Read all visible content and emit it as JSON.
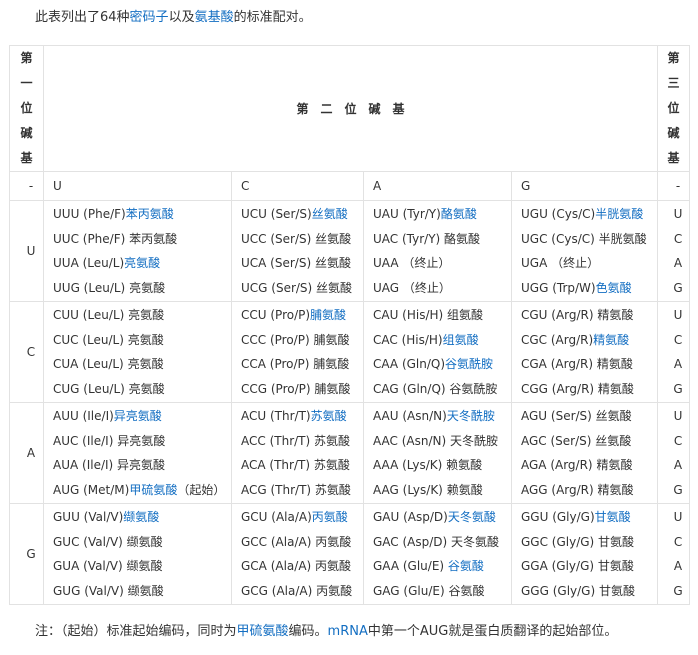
{
  "intro": {
    "text_before": "此表列出了64种",
    "link1": "密码子",
    "text_mid": "以及",
    "link2": "氨基酸",
    "text_after": "的标准配对。"
  },
  "table": {
    "first_base_header": "第一位碱基",
    "second_base_header": "第二位碱基",
    "third_base_header": "第三位碱基",
    "dash": "-",
    "second_bases": [
      "U",
      "C",
      "A",
      "G"
    ],
    "rows": [
      {
        "first": "U",
        "third": [
          "U",
          "C",
          "A",
          "G"
        ],
        "cells": [
          [
            {
              "code": "UUU (Phe/F)",
              "aa": "苯丙氨酸",
              "link": true
            },
            {
              "code": "UUC (Phe/F) ",
              "aa": "苯丙氨酸",
              "link": false
            },
            {
              "code": "UUA (Leu/L)",
              "aa": "亮氨酸",
              "link": true
            },
            {
              "code": "UUG (Leu/L) ",
              "aa": "亮氨酸",
              "link": false
            }
          ],
          [
            {
              "code": "UCU (Ser/S)",
              "aa": "丝氨酸",
              "link": true
            },
            {
              "code": "UCC (Ser/S) ",
              "aa": "丝氨酸",
              "link": false
            },
            {
              "code": "UCA (Ser/S) ",
              "aa": "丝氨酸",
              "link": false
            },
            {
              "code": "UCG (Ser/S) ",
              "aa": "丝氨酸",
              "link": false
            }
          ],
          [
            {
              "code": "UAU (Tyr/Y)",
              "aa": "酪氨酸",
              "link": true
            },
            {
              "code": "UAC (Tyr/Y) ",
              "aa": "酪氨酸",
              "link": false
            },
            {
              "code": "UAA ",
              "aa": "（终止）",
              "link": false
            },
            {
              "code": "UAG ",
              "aa": "（终止）",
              "link": false
            }
          ],
          [
            {
              "code": "UGU (Cys/C)",
              "aa": "半胱氨酸",
              "link": true
            },
            {
              "code": "UGC (Cys/C) ",
              "aa": "半胱氨酸",
              "link": false
            },
            {
              "code": "UGA ",
              "aa": "（终止）",
              "link": false
            },
            {
              "code": "UGG (Trp/W)",
              "aa": "色氨酸",
              "link": true
            }
          ]
        ]
      },
      {
        "first": "C",
        "third": [
          "U",
          "C",
          "A",
          "G"
        ],
        "cells": [
          [
            {
              "code": "CUU (Leu/L) ",
              "aa": "亮氨酸",
              "link": false
            },
            {
              "code": "CUC (Leu/L) ",
              "aa": "亮氨酸",
              "link": false
            },
            {
              "code": "CUA (Leu/L) ",
              "aa": "亮氨酸",
              "link": false
            },
            {
              "code": "CUG (Leu/L) ",
              "aa": "亮氨酸",
              "link": false
            }
          ],
          [
            {
              "code": "CCU (Pro/P)",
              "aa": "脯氨酸",
              "link": true
            },
            {
              "code": "CCC (Pro/P) ",
              "aa": "脯氨酸",
              "link": false
            },
            {
              "code": "CCA (Pro/P) ",
              "aa": "脯氨酸",
              "link": false
            },
            {
              "code": "CCG (Pro/P) ",
              "aa": "脯氨酸",
              "link": false
            }
          ],
          [
            {
              "code": "CAU (His/H) ",
              "aa": "组氨酸",
              "link": false
            },
            {
              "code": "CAC (His/H)",
              "aa": "组氨酸",
              "link": true
            },
            {
              "code": "CAA (Gln/Q)",
              "aa": "谷氨酰胺",
              "link": true
            },
            {
              "code": "CAG (Gln/Q) ",
              "aa": "谷氨酰胺",
              "link": false
            }
          ],
          [
            {
              "code": "CGU (Arg/R) ",
              "aa": "精氨酸",
              "link": false
            },
            {
              "code": "CGC (Arg/R)",
              "aa": "精氨酸",
              "link": true
            },
            {
              "code": "CGA (Arg/R) ",
              "aa": "精氨酸",
              "link": false
            },
            {
              "code": "CGG (Arg/R) ",
              "aa": "精氨酸",
              "link": false
            }
          ]
        ]
      },
      {
        "first": "A",
        "third": [
          "U",
          "C",
          "A",
          "G"
        ],
        "cells": [
          [
            {
              "code": "AUU (Ile/I)",
              "aa": "异亮氨酸",
              "link": true
            },
            {
              "code": "AUC (Ile/I) ",
              "aa": "异亮氨酸",
              "link": false
            },
            {
              "code": "AUA (Ile/I) ",
              "aa": "异亮氨酸",
              "link": false
            },
            {
              "code": "AUG (Met/M)",
              "aa": "甲硫氨酸",
              "link": true,
              "suffix": "（起始）"
            }
          ],
          [
            {
              "code": "ACU (Thr/T)",
              "aa": "苏氨酸",
              "link": true
            },
            {
              "code": "ACC (Thr/T) ",
              "aa": "苏氨酸",
              "link": false
            },
            {
              "code": "ACA (Thr/T) ",
              "aa": "苏氨酸",
              "link": false
            },
            {
              "code": "ACG (Thr/T) ",
              "aa": "苏氨酸",
              "link": false
            }
          ],
          [
            {
              "code": "AAU (Asn/N)",
              "aa": "天冬酰胺",
              "link": true
            },
            {
              "code": "AAC (Asn/N) ",
              "aa": "天冬酰胺",
              "link": false
            },
            {
              "code": "AAA (Lys/K) ",
              "aa": "赖氨酸",
              "link": false
            },
            {
              "code": "AAG (Lys/K) ",
              "aa": "赖氨酸",
              "link": false
            }
          ],
          [
            {
              "code": "AGU (Ser/S) ",
              "aa": "丝氨酸",
              "link": false
            },
            {
              "code": "AGC (Ser/S) ",
              "aa": "丝氨酸",
              "link": false
            },
            {
              "code": "AGA (Arg/R) ",
              "aa": "精氨酸",
              "link": false
            },
            {
              "code": "AGG (Arg/R) ",
              "aa": "精氨酸",
              "link": false
            }
          ]
        ]
      },
      {
        "first": "G",
        "third": [
          "U",
          "C",
          "A",
          "G"
        ],
        "cells": [
          [
            {
              "code": "GUU (Val/V)",
              "aa": "缬氨酸",
              "link": true
            },
            {
              "code": "GUC (Val/V) ",
              "aa": "缬氨酸",
              "link": false
            },
            {
              "code": "GUA (Val/V) ",
              "aa": "缬氨酸",
              "link": false
            },
            {
              "code": "GUG (Val/V) ",
              "aa": "缬氨酸",
              "link": false
            }
          ],
          [
            {
              "code": "GCU (Ala/A)",
              "aa": "丙氨酸",
              "link": true
            },
            {
              "code": "GCC (Ala/A) ",
              "aa": "丙氨酸",
              "link": false
            },
            {
              "code": "GCA (Ala/A) ",
              "aa": "丙氨酸",
              "link": false
            },
            {
              "code": "GCG (Ala/A) ",
              "aa": "丙氨酸",
              "link": false
            }
          ],
          [
            {
              "code": "GAU (Asp/D)",
              "aa": "天冬氨酸",
              "link": true
            },
            {
              "code": "GAC (Asp/D) ",
              "aa": "天冬氨酸",
              "link": false
            },
            {
              "code": "GAA (Glu/E) ",
              "aa": "谷氨酸",
              "link": true
            },
            {
              "code": "GAG (Glu/E) ",
              "aa": "谷氨酸",
              "link": false
            }
          ],
          [
            {
              "code": "GGU (Gly/G)",
              "aa": "甘氨酸",
              "link": true
            },
            {
              "code": "GGC (Gly/G) ",
              "aa": "甘氨酸",
              "link": false
            },
            {
              "code": "GGA (Gly/G) ",
              "aa": "甘氨酸",
              "link": false
            },
            {
              "code": "GGG (Gly/G) ",
              "aa": "甘氨酸",
              "link": false
            }
          ]
        ]
      }
    ]
  },
  "note": {
    "text_before": "注：（起始）标准起始编码，同时为",
    "link1": "甲硫氨酸",
    "text_mid": "编码。",
    "link2": "mRNA",
    "text_after": "中第一个AUG就是蛋白质翻译的起始部位。"
  },
  "colors": {
    "link": "#136ec2",
    "border": "#e2e2e2",
    "text": "#333333"
  }
}
